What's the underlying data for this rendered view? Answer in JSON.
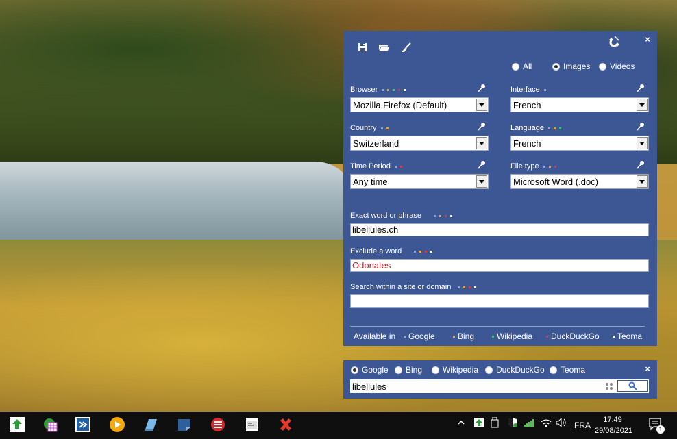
{
  "panel": {
    "toolbar": {
      "save_icon": "floppy-disk-icon",
      "open_icon": "folder-open-icon",
      "clear_icon": "broom-icon",
      "magnet_icon": "magnet-icon",
      "close_label": "×"
    },
    "media": {
      "options": [
        "All",
        "Images",
        "Videos"
      ],
      "selected": "Images"
    },
    "fields": {
      "browser": {
        "label": "Browser",
        "value": "Mozilla Firefox (Default)"
      },
      "interface": {
        "label": "Interface",
        "value": "French"
      },
      "country": {
        "label": "Country",
        "value": "Switzerland"
      },
      "language": {
        "label": "Language",
        "value": "French"
      },
      "time_period": {
        "label": "Time Period",
        "value": "Any time"
      },
      "file_type": {
        "label": "File type",
        "value": "Microsoft Word (.doc)"
      }
    },
    "exact": {
      "label": "Exact word or phrase",
      "value": "libellules.ch"
    },
    "exclude": {
      "label": "Exclude a word",
      "value": "Odonates"
    },
    "site": {
      "label": "Search within a site or domain",
      "value": ""
    },
    "available": {
      "label": "Available in",
      "engines": [
        "Google",
        "Bing",
        "Wikipedia",
        "DuckDuckGo",
        "Teoma"
      ]
    },
    "engine_colors": {
      "Google": "#8fa7d8",
      "Bing": "#f0a030",
      "Wikipedia": "#39c46a",
      "DuckDuckGo": "#d9364a",
      "Teoma": "#ffffff"
    }
  },
  "searchbar": {
    "engines": [
      "Google",
      "Bing",
      "Wikipedia",
      "DuckDuckGo",
      "Teoma"
    ],
    "selected": "Google",
    "query": "libellules",
    "close_label": "×"
  },
  "taskbar": {
    "tray": {
      "language": "FRA",
      "time": "17:49",
      "date": "29/08/2021",
      "notifications": "1"
    }
  }
}
